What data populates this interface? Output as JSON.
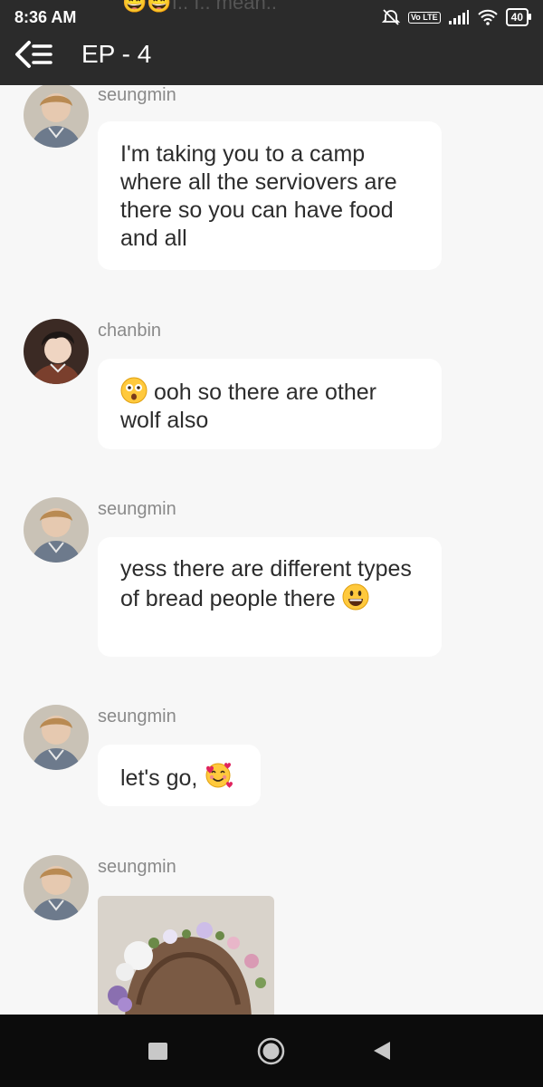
{
  "status_bar": {
    "time": "8:36 AM",
    "behind_text": "😄😄I.. I.. mean..",
    "volte": "Vo LTE",
    "battery": "40"
  },
  "header": {
    "title": "EP - 4"
  },
  "messages": [
    {
      "sender": "seungmin",
      "text": "I'm taking you to a camp where all the serviovers are there so you can have food and all"
    },
    {
      "sender": "chanbin",
      "emoji": "astonished-face-emoji",
      "text": "ooh so there are other wolf also"
    },
    {
      "sender": "seungmin",
      "text": "yess there are different types of bread people there",
      "emoji": "grinning-face-emoji"
    },
    {
      "sender": "seungmin",
      "text": "let's go,",
      "emoji": "smiling-face-with-hearts-emoji"
    },
    {
      "sender": "seungmin",
      "image": "flower-crown-photo"
    }
  ],
  "icons": {
    "back": "back-menu-icon",
    "alarm_off": "alarm-off-icon",
    "signal": "signal-icon",
    "wifi": "wifi-icon",
    "battery": "battery-icon",
    "recent": "recent-apps-icon",
    "home": "home-icon",
    "back_nav": "back-triangle-icon"
  },
  "colors": {
    "topbar": "#2b2b2b",
    "background": "#f7f7f7",
    "bubble": "#ffffff",
    "name": "#8a8a8a",
    "nav_bar": "#0c0c0c"
  }
}
